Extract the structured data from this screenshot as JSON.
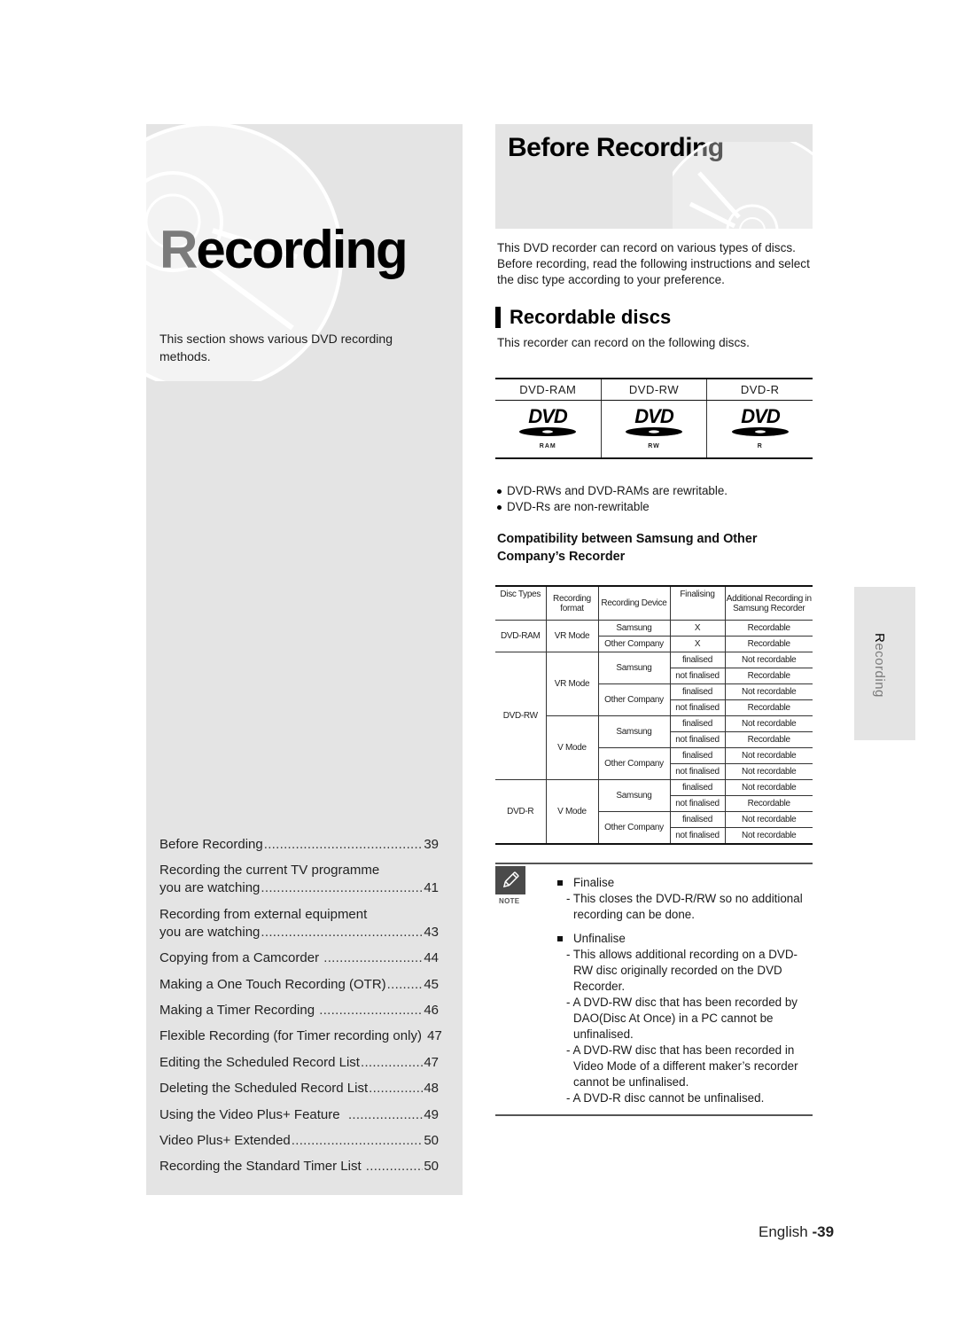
{
  "chapter": {
    "title_initial": "R",
    "title_rest": "ecording",
    "intro": "This section shows various DVD recording methods."
  },
  "toc": [
    {
      "title": "Before Recording",
      "page": "39"
    },
    {
      "title_line1": "Recording the current TV programme",
      "title": "you are watching",
      "page": "41"
    },
    {
      "title_line1": "Recording from external equipment",
      "title": "you are watching",
      "page": "43"
    },
    {
      "title": "Copying from a Camcorder ",
      "page": "44"
    },
    {
      "title": "Making a One Touch Recording (OTR)",
      "page": "45"
    },
    {
      "title": "Making a Timer Recording ",
      "page": "46"
    },
    {
      "title": "Flexible Recording (for Timer recording only) ",
      "page": "47"
    },
    {
      "title": "Editing the Scheduled Record List",
      "page": "47"
    },
    {
      "title": "Deleting the Scheduled Record List",
      "page": "48"
    },
    {
      "title": "Using the Video Plus+ Feature  ",
      "page": "49"
    },
    {
      "title": "Video Plus+ Extended",
      "page": "50"
    },
    {
      "title": "Recording the Standard Timer List ",
      "page": "50"
    }
  ],
  "page": {
    "title": "Before Recording",
    "intro": "This DVD recorder can record on various types of discs. Before recording, read the following instructions and select the disc type according to your preference.",
    "subheading": "Recordable discs",
    "sub_intro": "This recorder can record on the following discs."
  },
  "discs": [
    {
      "label": "DVD-RAM",
      "logo_text": "DVD",
      "logo_sub": "RAM",
      "icon": "dvd-ram-logo-icon"
    },
    {
      "label": "DVD-RW",
      "logo_text": "DVD",
      "logo_sub": "RW",
      "icon": "dvd-rw-logo-icon"
    },
    {
      "label": "DVD-R",
      "logo_text": "DVD",
      "logo_sub": "R",
      "icon": "dvd-r-logo-icon"
    }
  ],
  "bullets": [
    "DVD-RWs and DVD-RAMs are rewritable.",
    "DVD-Rs are non-rewritable"
  ],
  "compat": {
    "title": "Compatibility between Samsung and Other Company’s Recorder",
    "headers": {
      "disc_types": "Disc Types",
      "recording_format": "Recording format",
      "recording_device": "Recording Device",
      "finalising": "Finalising",
      "additional": "Additional Recording in Samsung Recorder"
    },
    "dvd_ram": {
      "disc": "DVD-RAM",
      "format": "VR Mode",
      "rows": [
        {
          "device": "Samsung",
          "finalising": "X",
          "result": "Recordable"
        },
        {
          "device": "Other Company",
          "finalising": "X",
          "result": "Recordable"
        }
      ]
    },
    "dvd_rw": {
      "disc": "DVD-RW",
      "vr_format": "VR Mode",
      "v_format": "V Mode",
      "vr_samsung": "Samsung",
      "vr_other": "Other Company",
      "v_samsung": "Samsung",
      "v_other": "Other Company",
      "rows": [
        {
          "finalising": "finalised",
          "result": "Not recordable"
        },
        {
          "finalising": "not finalised",
          "result": "Recordable"
        },
        {
          "finalising": "finalised",
          "result": "Not recordable"
        },
        {
          "finalising": "not finalised",
          "result": "Recordable"
        },
        {
          "finalising": "finalised",
          "result": "Not recordable"
        },
        {
          "finalising": "not finalised",
          "result": "Recordable"
        },
        {
          "finalising": "finalised",
          "result": "Not recordable"
        },
        {
          "finalising": "not finalised",
          "result": "Not recordable"
        }
      ]
    },
    "dvd_r": {
      "disc": "DVD-R",
      "format": "V Mode",
      "samsung": "Samsung",
      "other": "Other Company",
      "rows": [
        {
          "finalising": "finalised",
          "result": "Not recordable"
        },
        {
          "finalising": "not finalised",
          "result": "Recordable"
        },
        {
          "finalising": "finalised",
          "result": "Not recordable"
        },
        {
          "finalising": "not finalised",
          "result": "Not recordable"
        }
      ]
    }
  },
  "note": {
    "label": "NOTE",
    "items": [
      {
        "head": "Finalise",
        "subs": [
          "- This closes the DVD-R/RW so no additional recording can be done."
        ]
      },
      {
        "head": "Unfinalise",
        "subs": [
          "- This allows additional recording on a DVD-RW disc originally recorded on the DVD Recorder.",
          "- A DVD-RW disc that has been recorded by DAO(Disc At Once) in a PC cannot be unfinalised.",
          "- A DVD-RW disc that has been recorded in Video Mode of a different maker’s recorder cannot be unfinalised.",
          "- A DVD-R disc cannot be unfinalised."
        ]
      }
    ]
  },
  "side_tab": {
    "initial": "R",
    "rest": "ecording"
  },
  "footer": {
    "language": "English ",
    "page": "-39"
  }
}
